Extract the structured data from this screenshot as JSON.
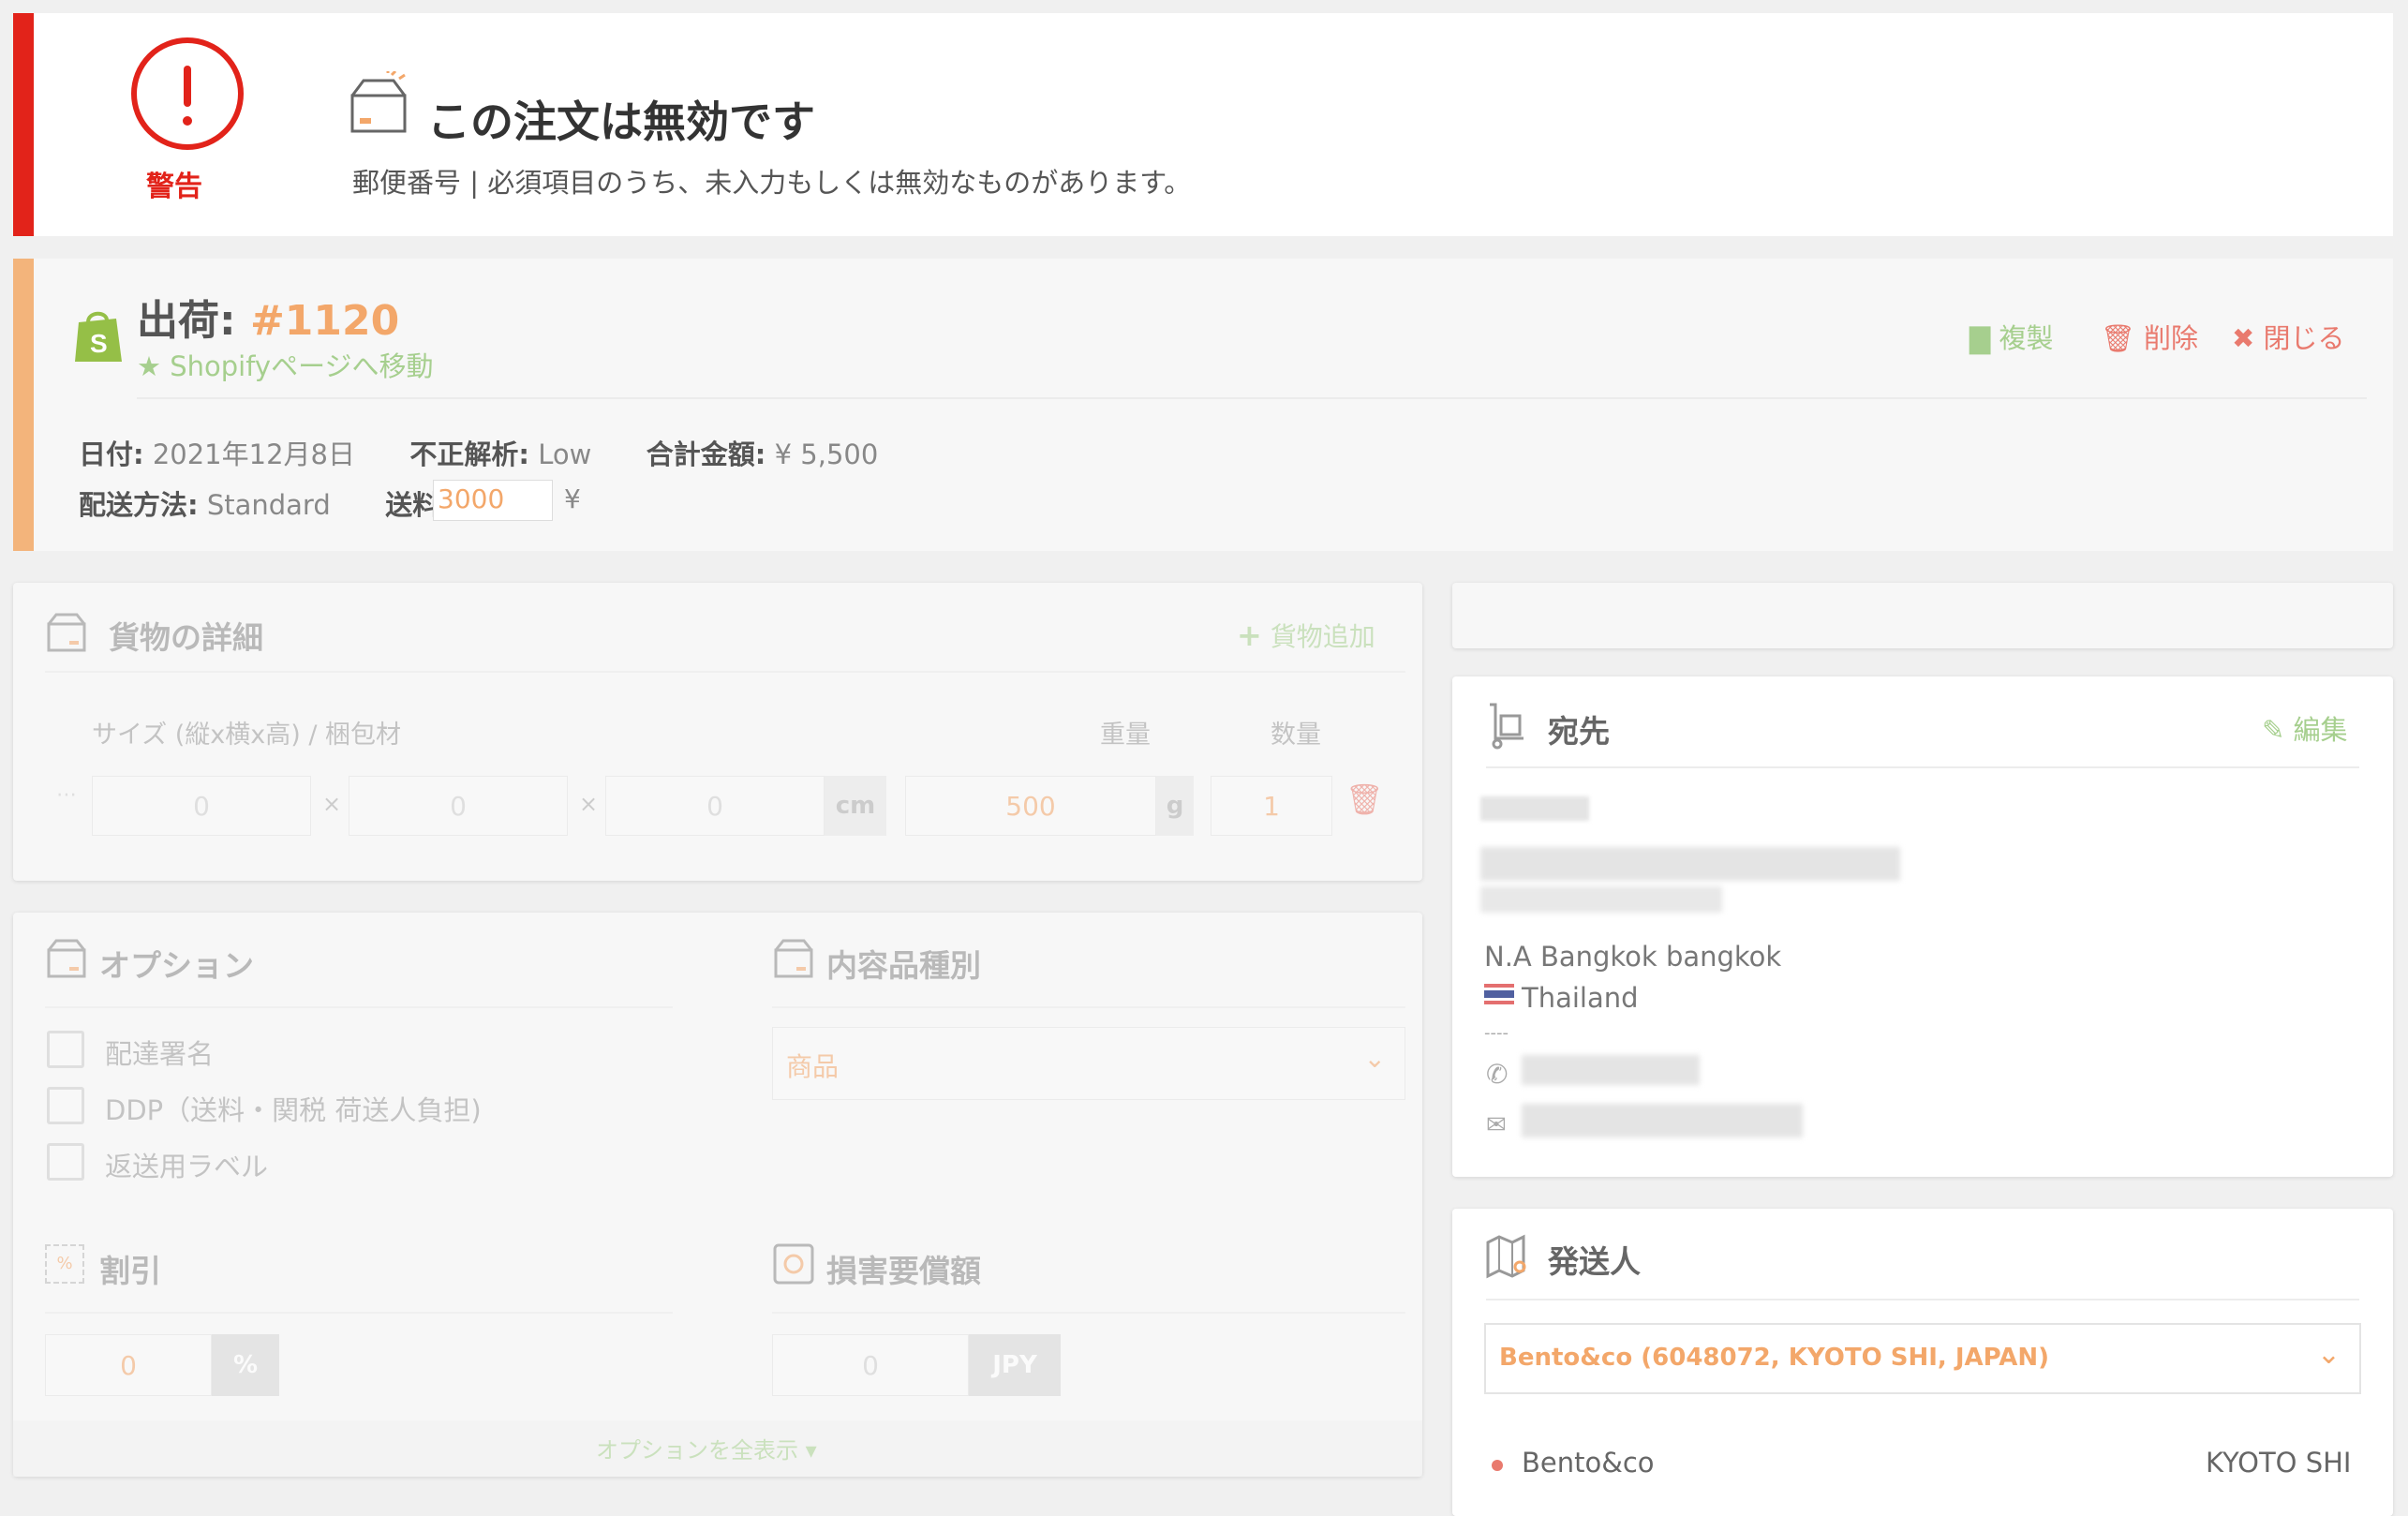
{
  "warning": {
    "label": "警告",
    "title": "この注文は無効です",
    "message": "郵便番号 | 必須項目のうち、未入力もしくは無効なものがあります。"
  },
  "shipment": {
    "title_label": "出荷:",
    "order_number": "#1120",
    "shopify_link": "★ Shopifyページへ移動",
    "actions": {
      "duplicate": "複製",
      "delete": "削除",
      "close": "閉じる"
    },
    "date_label": "日付:",
    "date_value": "2021年12月8日",
    "fraud_label": "不正解析:",
    "fraud_value": "Low",
    "total_label": "合計金額:",
    "total_value": "¥ 5,500",
    "method_label": "配送方法:",
    "method_value": "Standard",
    "fee_label": "送料:",
    "fee_value": "3000",
    "fee_currency": "¥"
  },
  "cargo": {
    "title": "貨物の詳細",
    "add": "貨物追加",
    "size_header": "サイズ (縦x横x高) / 梱包材",
    "weight_header": "重量",
    "qty_header": "数量",
    "dim1": "0",
    "dim2": "0",
    "dim3": "0",
    "x_sep": "×",
    "dim_unit": "cm",
    "weight": "500",
    "weight_unit": "g",
    "qty": "1",
    "handle": "⋯"
  },
  "options": {
    "title": "オプション",
    "checkboxes": [
      "配達署名",
      "DDP（送料・関税 荷送人負担)",
      "返送用ラベル"
    ],
    "content_title": "内容品種別",
    "content_selected": "商品",
    "discount_title": "割引",
    "discount_value": "0",
    "discount_unit": "%",
    "insurance_title": "損害要償額",
    "insurance_value": "0",
    "insurance_unit": "JPY",
    "show_all": "オプションを全表示 ▾"
  },
  "recipient": {
    "title": "宛先",
    "edit": "編集",
    "city_line": "N.A Bangkok bangkok",
    "country": "Thailand",
    "dashes": "----"
  },
  "sender": {
    "title": "発送人",
    "selected": "Bento&co (6048072, KYOTO SHI, JAPAN)",
    "name": "Bento&co",
    "city": "KYOTO SHI"
  }
}
